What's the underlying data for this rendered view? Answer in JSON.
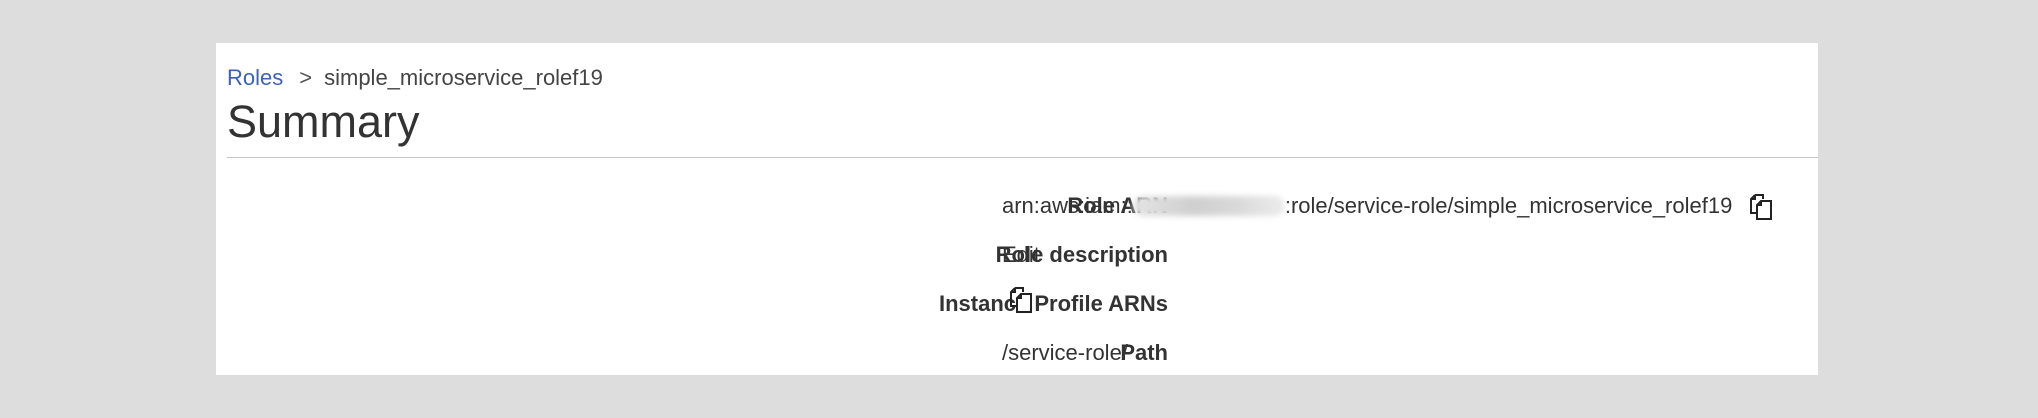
{
  "breadcrumb": {
    "parent_label": "Roles",
    "separator": ">",
    "current_label": "simple_microservice_rolef19"
  },
  "page": {
    "title": "Summary"
  },
  "details": {
    "role_arn": {
      "label": "Role ARN",
      "value_prefix": "arn:aws:iam::",
      "value_suffix": ":role/service-role/simple_microservice_rolef19",
      "copy_icon": "copy-icon"
    },
    "role_description": {
      "label": "Role description",
      "action": "Edit"
    },
    "instance_profile_arns": {
      "label": "Instance Profile ARNs",
      "copy_icon": "copy-icon"
    },
    "path": {
      "label": "Path",
      "value": "/service-role/"
    }
  },
  "colors": {
    "link": "#3b63b8",
    "background": "#dddddd",
    "panel": "#ffffff"
  }
}
